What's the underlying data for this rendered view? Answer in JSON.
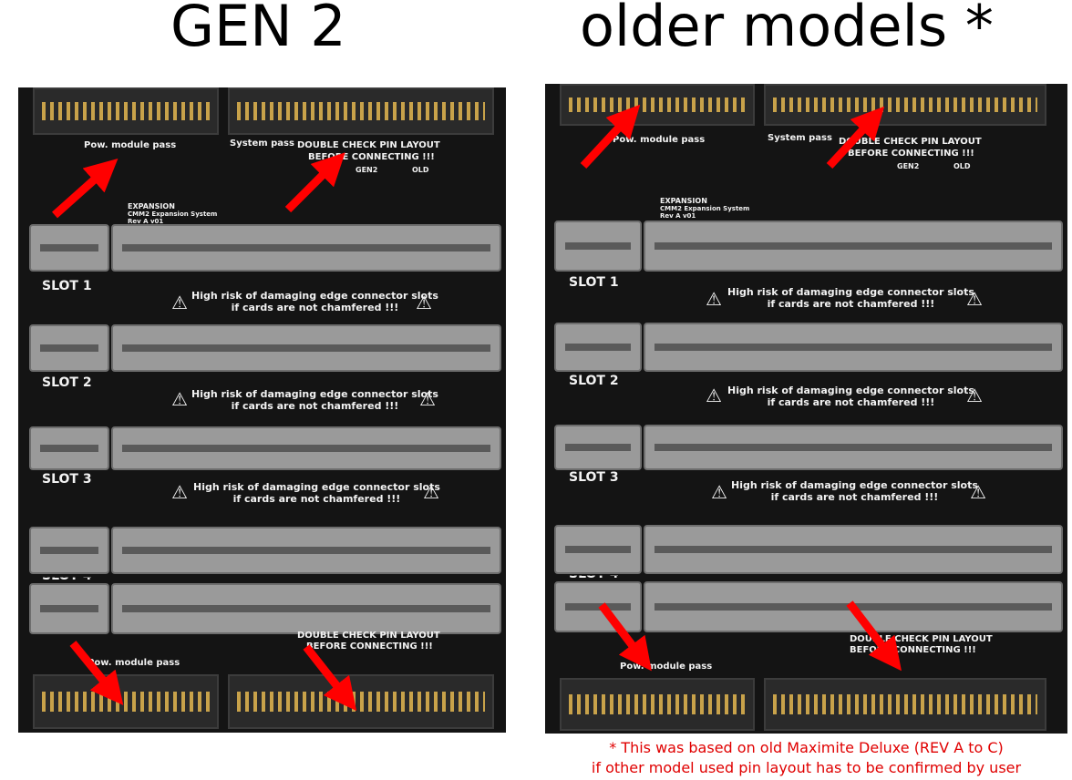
{
  "headings": {
    "left": "GEN 2",
    "right": "older models *"
  },
  "boards": {
    "left": {
      "silk": {
        "pow_pass_top": "Pow. module pass",
        "system_pass": "System pass",
        "double_check": "DOUBLE CHECK PIN LAYOUT",
        "before_connecting": "BEFORE CONNECTING !!!",
        "gen2": "GEN2",
        "old": "OLD",
        "expansion": "EXPANSION",
        "expansion_sub": "CMM2 Expansion System",
        "rev": "Rev A v01",
        "pow_pass_bottom": "Pow. module pass",
        "double_check_bottom": "DOUBLE CHECK PIN LAYOUT",
        "before_connecting_bottom": "BEFORE CONNECTING !!!"
      },
      "slots": [
        "SLOT 1",
        "SLOT 2",
        "SLOT 3",
        "SLOT 4"
      ],
      "warning_line1": "High risk of damaging edge connector slots",
      "warning_line2": "if cards are not chamfered !!!"
    },
    "right": {
      "silk": {
        "pow_pass_top": "Pow. module pass",
        "system_pass": "System pass",
        "double_check": "DOUBLE CHECK PIN LAYOUT",
        "before_connecting": "BEFORE CONNECTING !!!",
        "gen2": "GEN2",
        "old": "OLD",
        "expansion": "EXPANSION",
        "expansion_sub": "CMM2 Expansion System",
        "rev": "Rev A v01",
        "pow_pass_bottom": "Pow. module pass",
        "double_check_bottom": "DOUBLE CHECK PIN LAYOUT",
        "before_connecting_bottom": "BEFORE CONNECTING !!!"
      },
      "slots": [
        "SLOT 1",
        "SLOT 2",
        "SLOT 3",
        "SLOT 4"
      ],
      "warning_line1": "High risk of damaging edge connector slots",
      "warning_line2": "if cards are not chamfered !!!"
    }
  },
  "footnote": {
    "line1": "* This was based on old Maximite Deluxe (REV A to C)",
    "line2": "if other model used pin layout has to be confirmed by user"
  },
  "colors": {
    "arrow": "#ff0000",
    "board": "#141414",
    "slot": "#9a9a9a",
    "footnote": "#e00000",
    "pins": "#c8a24a"
  }
}
